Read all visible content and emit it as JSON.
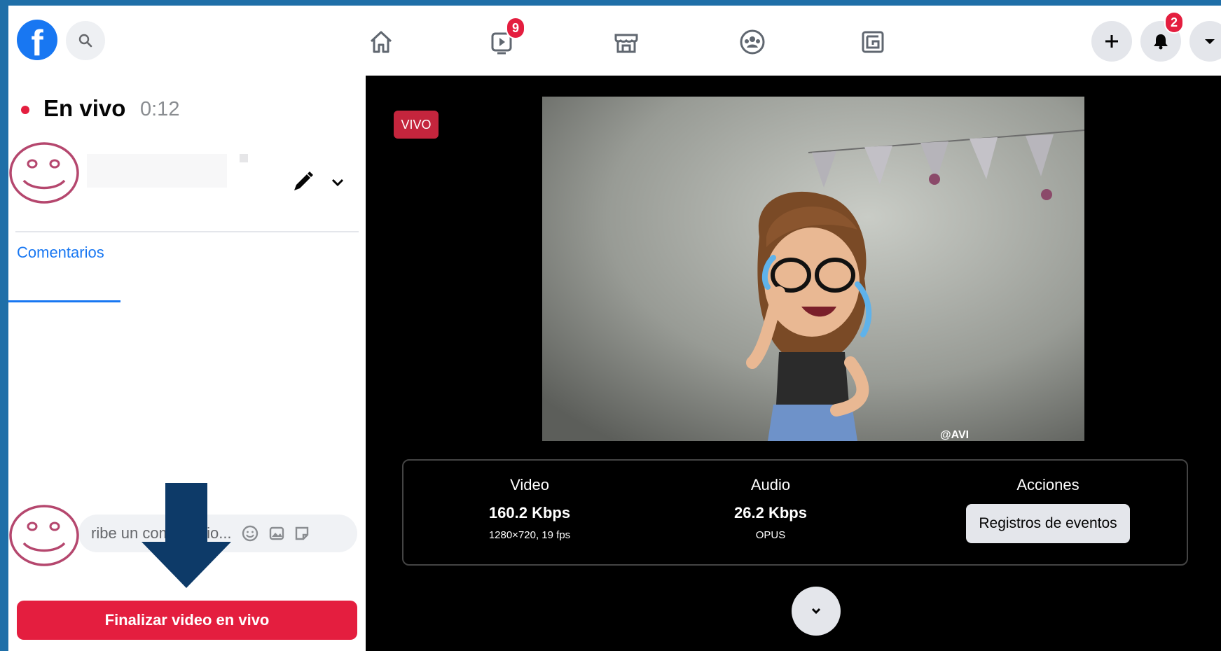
{
  "topbar": {
    "notifications_badge": "2",
    "watch_badge": "9",
    "icons": [
      "facebook-logo",
      "search-icon",
      "home-icon",
      "watch-icon",
      "marketplace-icon",
      "groups-icon",
      "gaming-icon",
      "plus-icon",
      "bell-icon",
      "caret-down-icon"
    ]
  },
  "left": {
    "live_title": "En vivo",
    "live_time": "0:12",
    "tabs": [
      "Comentarios"
    ],
    "comment_placeholder": "ribe un comentario...",
    "end_live_button": "Finalizar video en vivo"
  },
  "right": {
    "live_badge": "VIVO",
    "watermark": "@AVI",
    "stats": {
      "video": {
        "label": "Video",
        "value": "160.2 Kbps",
        "detail": "1280×720, 19 fps"
      },
      "audio": {
        "label": "Audio",
        "value": "26.2 Kbps",
        "detail": "OPUS"
      },
      "actions": {
        "label": "Acciones",
        "button": "Registros de eventos"
      }
    }
  },
  "colors": {
    "brand": "#1877f2",
    "live_red": "#e41e3f",
    "annotation": "#b5476e",
    "arrow": "#0d3a68"
  }
}
